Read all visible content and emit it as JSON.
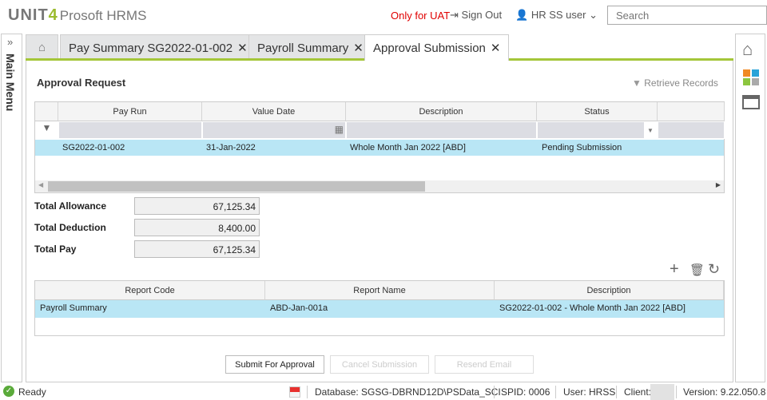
{
  "header": {
    "brand": "UNIT",
    "brand_num": "4",
    "product": "Prosoft HRMS",
    "env_label": "Only for UAT",
    "sign_out": "Sign Out",
    "user": "HR SS user",
    "search_placeholder": "Search"
  },
  "sidebar": {
    "title": "Main Menu"
  },
  "tabs": [
    {
      "label": "Pay Summary SG2022-01-002"
    },
    {
      "label": "Payroll Summary"
    },
    {
      "label": "Approval Submission"
    }
  ],
  "section": {
    "title": "Approval Request",
    "retrieve": "Retrieve Records"
  },
  "grid1": {
    "columns": [
      "Pay Run",
      "Value Date",
      "Description",
      "Status"
    ],
    "rows": [
      {
        "pay_run": "SG2022-01-002",
        "value_date": "31-Jan-2022",
        "description": "Whole Month Jan 2022 [ABD]",
        "status": "Pending Submission"
      }
    ]
  },
  "totals": {
    "allowance_label": "Total Allowance",
    "allowance": "67,125.34",
    "deduction_label": "Total Deduction",
    "deduction": "8,400.00",
    "pay_label": "Total Pay",
    "pay": "67,125.34"
  },
  "grid2": {
    "columns": [
      "Report Code",
      "Report Name",
      "Description"
    ],
    "rows": [
      {
        "code": "Payroll Summary",
        "name": "ABD-Jan-001a",
        "description": "SG2022-01-002 - Whole Month Jan 2022 [ABD]"
      }
    ]
  },
  "buttons": {
    "submit": "Submit For Approval",
    "cancel": "Cancel Submission",
    "resend": "Resend Email"
  },
  "statusbar": {
    "ready": "Ready",
    "database": "Database: SGSG-DBRND12D\\PSData_SCI",
    "spid": "SPID: 0006",
    "user": "User: HRSS",
    "client": "Client:",
    "version": "Version: 9.22.050.8"
  }
}
